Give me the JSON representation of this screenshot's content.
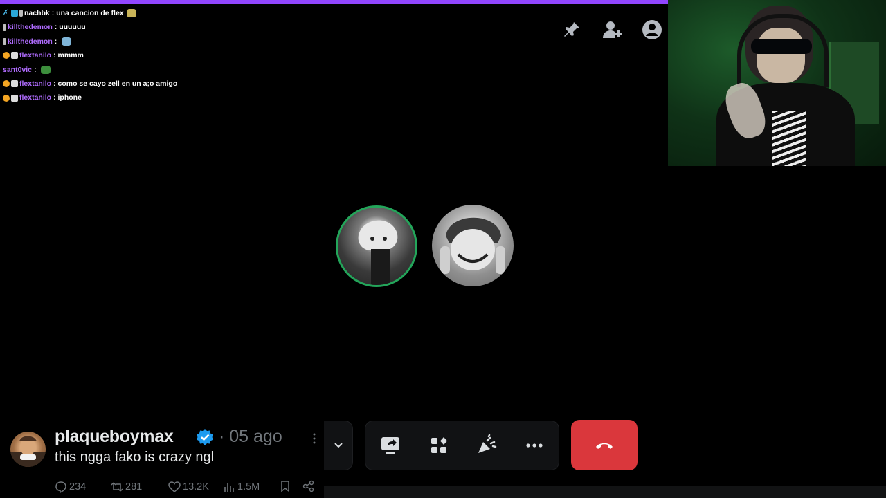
{
  "chat": [
    {
      "user": "nachbk",
      "user_color": "#ffffff",
      "message": "una cancion de flex",
      "emote_color": "#c9b458"
    },
    {
      "user": "killthedemon",
      "user_color": "#b06cff",
      "message": "uuuuuu",
      "emote_color": ""
    },
    {
      "user": "killthedemon",
      "user_color": "#b06cff",
      "message": "",
      "emote_color": "#7fb5d8"
    },
    {
      "user": "flextanilo",
      "user_color": "#b06cff",
      "message": "mmmm",
      "emote_color": ""
    },
    {
      "user": "sant0vic",
      "user_color": "#b06cff",
      "message": "",
      "emote_color": "#3d8f3d"
    },
    {
      "user": "flextanilo",
      "user_color": "#b06cff",
      "message": "como se cayo zell en un a;o amigo",
      "emote_color": ""
    },
    {
      "user": "flextanilo",
      "user_color": "#b06cff",
      "message": "iphone",
      "emote_color": ""
    }
  ],
  "colors": {
    "accent_bar": "#9146ff",
    "speaking_ring": "#23a55a",
    "hangup": "#da373c",
    "verified": "#1d9bf0"
  },
  "call": {
    "top_icons": [
      "pin-icon",
      "add-user-icon",
      "profile-icon"
    ],
    "controls": [
      "screen-share-icon",
      "activities-icon",
      "soundboard-icon",
      "more-icon",
      "hangup-icon"
    ]
  },
  "tweet": {
    "name": "plaqueboymax",
    "date": "· 05 ago",
    "text": "this ngga fako is crazy ngl",
    "replies": "234",
    "reposts": "281",
    "likes": "13.2K",
    "views": "1.5M"
  }
}
